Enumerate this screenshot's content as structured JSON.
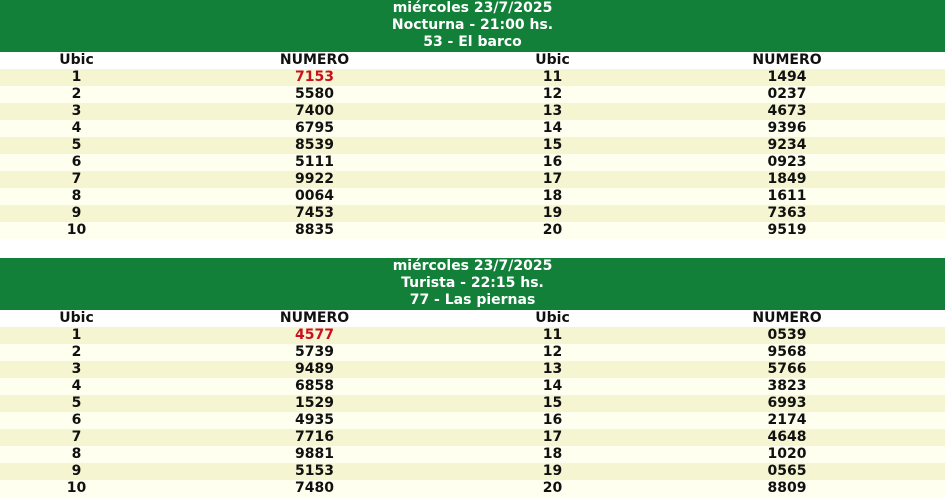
{
  "colors": {
    "header_bg": "#138039",
    "row_alt": "#f5f5d2",
    "row_plain": "#fffff0",
    "highlight": "#c8101e"
  },
  "columns": [
    "Ubic",
    "NUMERO",
    "Ubic",
    "NUMERO"
  ],
  "draws": [
    {
      "date": "miércoles 23/7/2025",
      "session": "Nocturna - 21:00 hs.",
      "result": "53 - El barco",
      "rows": [
        {
          "u1": "1",
          "n1": "7153",
          "u2": "11",
          "n2": "1494"
        },
        {
          "u1": "2",
          "n1": "5580",
          "u2": "12",
          "n2": "0237"
        },
        {
          "u1": "3",
          "n1": "7400",
          "u2": "13",
          "n2": "4673"
        },
        {
          "u1": "4",
          "n1": "6795",
          "u2": "14",
          "n2": "9396"
        },
        {
          "u1": "5",
          "n1": "8539",
          "u2": "15",
          "n2": "9234"
        },
        {
          "u1": "6",
          "n1": "5111",
          "u2": "16",
          "n2": "0923"
        },
        {
          "u1": "7",
          "n1": "9922",
          "u2": "17",
          "n2": "1849"
        },
        {
          "u1": "8",
          "n1": "0064",
          "u2": "18",
          "n2": "1611"
        },
        {
          "u1": "9",
          "n1": "7453",
          "u2": "19",
          "n2": "7363"
        },
        {
          "u1": "10",
          "n1": "8835",
          "u2": "20",
          "n2": "9519"
        }
      ]
    },
    {
      "date": "miércoles 23/7/2025",
      "session": "Turista - 22:15 hs.",
      "result": "77 - Las piernas",
      "rows": [
        {
          "u1": "1",
          "n1": "4577",
          "u2": "11",
          "n2": "0539"
        },
        {
          "u1": "2",
          "n1": "5739",
          "u2": "12",
          "n2": "9568"
        },
        {
          "u1": "3",
          "n1": "9489",
          "u2": "13",
          "n2": "5766"
        },
        {
          "u1": "4",
          "n1": "6858",
          "u2": "14",
          "n2": "3823"
        },
        {
          "u1": "5",
          "n1": "1529",
          "u2": "15",
          "n2": "6993"
        },
        {
          "u1": "6",
          "n1": "4935",
          "u2": "16",
          "n2": "2174"
        },
        {
          "u1": "7",
          "n1": "7716",
          "u2": "17",
          "n2": "4648"
        },
        {
          "u1": "8",
          "n1": "9881",
          "u2": "18",
          "n2": "1020"
        },
        {
          "u1": "9",
          "n1": "5153",
          "u2": "19",
          "n2": "0565"
        },
        {
          "u1": "10",
          "n1": "7480",
          "u2": "20",
          "n2": "8809"
        }
      ]
    }
  ]
}
